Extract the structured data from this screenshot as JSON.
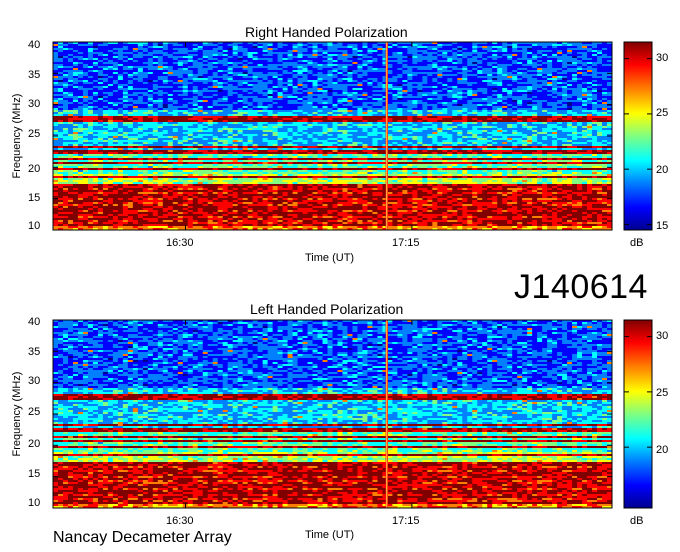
{
  "obs_id": "J140614",
  "footer": "Nancay Decameter Array",
  "colorbar": {
    "unit": "dB",
    "ticks": [
      "30",
      "25",
      "20",
      "15"
    ],
    "min": 14.5,
    "max": 31.5
  },
  "colormap": [
    "#00008f",
    "#0000ff",
    "#0080ff",
    "#00ffff",
    "#80ff80",
    "#ffff00",
    "#ff8000",
    "#ff0000",
    "#800000"
  ],
  "chart_data": [
    {
      "type": "heatmap",
      "title": "Right Handed Polarization",
      "xlabel": "Time (UT)",
      "ylabel": "Frequency (MHz)",
      "xticks": [
        "16:30",
        "17:15"
      ],
      "yticks": [
        "40",
        "35",
        "30",
        "25",
        "20",
        "15",
        "10"
      ],
      "ylim": [
        10,
        40
      ],
      "value_unit": "dB",
      "vertical_line_time": "~17:07"
    },
    {
      "type": "heatmap",
      "title": "Left Handed Polarization",
      "xlabel": "Time (UT)",
      "ylabel": "Frequency (MHz)",
      "xticks": [
        "16:30",
        "17:15"
      ],
      "yticks": [
        "40",
        "35",
        "30",
        "25",
        "20",
        "15",
        "10"
      ],
      "ylim": [
        10,
        40
      ],
      "value_unit": "dB",
      "vertical_line_time": "~17:07"
    }
  ]
}
